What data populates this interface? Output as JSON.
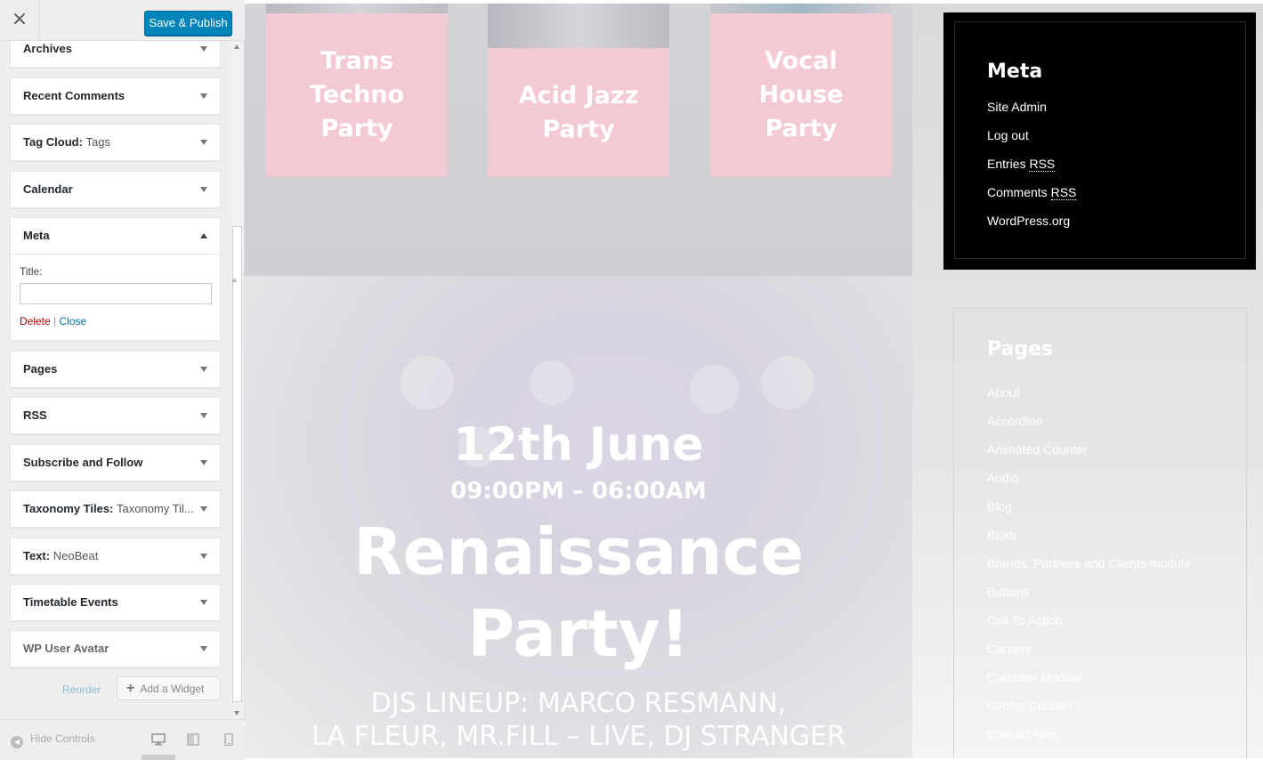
{
  "header": {
    "close_label": "×",
    "publish_label": "Save & Publish"
  },
  "widgets": [
    {
      "name": "Archives",
      "sub": ""
    },
    {
      "name": "Recent Comments",
      "sub": ""
    },
    {
      "name": "Tag Cloud:",
      "sub": "Tags"
    },
    {
      "name": "Calendar",
      "sub": ""
    },
    {
      "name": "Meta",
      "sub": ""
    },
    {
      "name": "Pages",
      "sub": ""
    },
    {
      "name": "RSS",
      "sub": ""
    },
    {
      "name": "Subscribe and Follow",
      "sub": ""
    },
    {
      "name": "Taxonomy Tiles:",
      "sub": "Taxonomy Til..."
    },
    {
      "name": "Text:",
      "sub": "NeoBeat"
    },
    {
      "name": "Timetable Events",
      "sub": ""
    },
    {
      "name": "WP User Avatar",
      "sub": ""
    }
  ],
  "meta_form": {
    "title_label": "Title:",
    "title_value": "",
    "delete_label": "Delete",
    "separator": "|",
    "close_label": "Close"
  },
  "actions": {
    "reorder_label": "Reorder",
    "add_widget_label": "Add a Widget",
    "add_widget_icon": "+"
  },
  "footer": {
    "hide_controls_label": "Hide Controls"
  },
  "preview": {
    "tiles": [
      "Trans\nTechno\nParty",
      "Acid Jazz\nParty",
      "Vocal\nHouse\nParty"
    ],
    "event": {
      "date": "12th June",
      "time": "09:00PM – 06:00AM",
      "title": "Renaissance\nParty!",
      "lineup": "DJS LINEUP: MARCO RESMANN,\nLA FLEUR, MR.FILL – LIVE, DJ STRANGER"
    },
    "meta": {
      "title": "Meta",
      "links": [
        "Site Admin",
        "Log out",
        "Entries",
        "Comments",
        "WordPress.org"
      ],
      "rss": "RSS"
    },
    "pages": {
      "title": "Pages",
      "links": [
        "About",
        "Accordion",
        "Animated Counter",
        "Audio",
        "Blog",
        "Blurb",
        "Brands, Partners and Clients module",
        "Buttons",
        "Call To Action",
        "Careers",
        "Carousel Module",
        "Circles Counter",
        "Contact form"
      ]
    }
  },
  "colors": {
    "publish": "#0085ba",
    "delete": "#aa0000",
    "close": "#0073aa",
    "tile": "#f3c9d3"
  }
}
